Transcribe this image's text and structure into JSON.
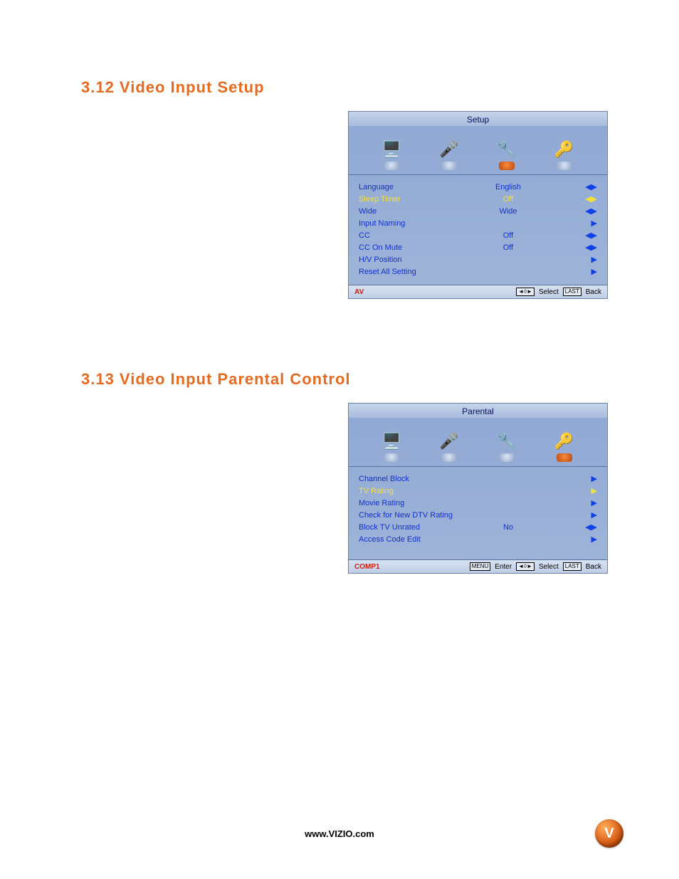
{
  "section1": {
    "heading": "3.12 Video Input Setup",
    "osd": {
      "title": "Setup",
      "active_tab": 2,
      "rows": [
        {
          "label": "Language",
          "value": "English",
          "arrow": "lr",
          "selected": false
        },
        {
          "label": "Sleep Timer",
          "value": "Off",
          "arrow": "lr",
          "selected": true
        },
        {
          "label": "Wide",
          "value": "Wide",
          "arrow": "lr",
          "selected": false
        },
        {
          "label": "Input Naming",
          "value": "",
          "arrow": "r",
          "selected": false
        },
        {
          "label": "CC",
          "value": "Off",
          "arrow": "lr",
          "selected": false
        },
        {
          "label": "CC On Mute",
          "value": "Off",
          "arrow": "lr",
          "selected": false
        },
        {
          "label": "H/V Position",
          "value": "",
          "arrow": "r",
          "selected": false
        },
        {
          "label": "Reset All Setting",
          "value": "",
          "arrow": "r",
          "selected": false
        }
      ],
      "source": "AV",
      "hints": [
        {
          "key": "◄◊►",
          "text": "Select"
        },
        {
          "key": "LAST",
          "text": "Back"
        }
      ]
    }
  },
  "section2": {
    "heading": "3.13 Video Input Parental Control",
    "osd": {
      "title": "Parental",
      "active_tab": 3,
      "rows": [
        {
          "label": "Channel Block",
          "value": "",
          "arrow": "r",
          "selected": false
        },
        {
          "label": "TV Rating",
          "value": "",
          "arrow": "r",
          "selected": true
        },
        {
          "label": "Movie Rating",
          "value": "",
          "arrow": "r",
          "selected": false
        },
        {
          "label": "Check for New DTV Rating",
          "value": "",
          "arrow": "r",
          "selected": false
        },
        {
          "label": "Block TV Unrated",
          "value": "No",
          "arrow": "lr",
          "selected": false
        },
        {
          "label": "Access Code Edit",
          "value": "",
          "arrow": "r",
          "selected": false
        }
      ],
      "source": "COMP1",
      "hints": [
        {
          "key": "MENU",
          "text": "Enter"
        },
        {
          "key": "◄◊►",
          "text": "Select"
        },
        {
          "key": "LAST",
          "text": "Back"
        }
      ]
    }
  },
  "footer_url": "www.VIZIO.com",
  "logo_letter": "V",
  "icons": [
    "🖥️",
    "🎤",
    "🔧",
    "🔑"
  ]
}
